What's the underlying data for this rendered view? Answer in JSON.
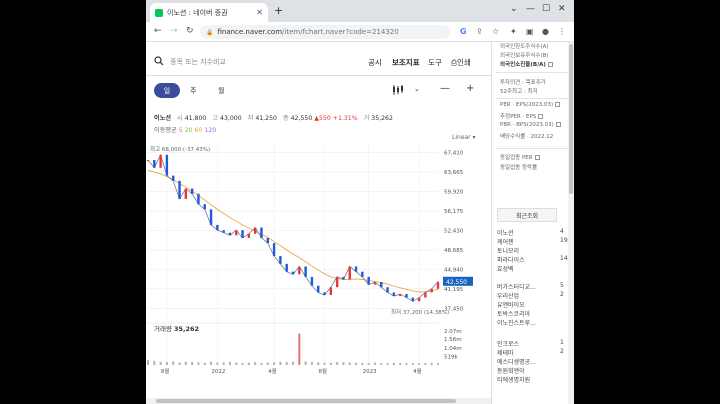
{
  "browser": {
    "tab_title": "이노션 : 네이버 증권",
    "url_host": "finance.naver.com",
    "url_path": "/item/fchart.naver?code=214320"
  },
  "search": {
    "placeholder": "종목 또는 지수비교"
  },
  "menu": {
    "disclosure": "공시",
    "indicator": "보조지표",
    "tools": "도구",
    "print": "인쇄"
  },
  "periods": [
    "일",
    "주",
    "월"
  ],
  "info": {
    "name": "이노션",
    "open_label": "시",
    "open": "41,800",
    "high_label": "고",
    "high": "43,000",
    "low_label": "저",
    "low": "41,250",
    "close_label": "종",
    "close": "42,550",
    "change": "▲550",
    "change_pct": "+1.31%",
    "volume_label": "거",
    "volume": "35,262",
    "ma_label": "이동평균",
    "ma": [
      "5",
      "20",
      "60",
      "120"
    ]
  },
  "chart": {
    "scale": "Linear ▾",
    "volume_label": "거래량",
    "volume_value": "35,262"
  },
  "chart_data": {
    "type": "line",
    "title": "",
    "price_ticks": [
      "67,410",
      "63,665",
      "59,920",
      "56,175",
      "52,430",
      "48,685",
      "44,940",
      "41,195",
      "37,450"
    ],
    "price_ticks_values": [
      67410,
      63665,
      59920,
      56175,
      52430,
      48685,
      44940,
      41195,
      37450
    ],
    "ylim": [
      35577,
      69282
    ],
    "current_price_label": "42,550",
    "current_price": 42550,
    "max_label": "최고 68,000 (-37.43%)",
    "min_label": "최저 37,200 (14.38%)",
    "volume_ticks": [
      "2.07m",
      "1.56m",
      "1.04m",
      "519k"
    ],
    "x_tick_labels": [
      "8월",
      "2022",
      "4월",
      "8월",
      "2023",
      "4월"
    ],
    "x": [
      0,
      2,
      4,
      6,
      8,
      10,
      12,
      14,
      16,
      18,
      20,
      22,
      24,
      26,
      28,
      30,
      32,
      34,
      36,
      38,
      40,
      42,
      44,
      46,
      48,
      50,
      52,
      54,
      56,
      58,
      60,
      62,
      64,
      66,
      68,
      70,
      72,
      74,
      76,
      78,
      80,
      82,
      84,
      86,
      88,
      90,
      92
    ],
    "close": [
      66000,
      64500,
      67000,
      63000,
      62000,
      58500,
      60500,
      59500,
      57500,
      56500,
      53500,
      52500,
      52000,
      51500,
      52500,
      51000,
      51800,
      53000,
      51000,
      50000,
      47500,
      46000,
      44500,
      44000,
      45500,
      43500,
      41800,
      40500,
      40000,
      41500,
      43500,
      43000,
      45500,
      44500,
      43500,
      42000,
      42500,
      41500,
      40500,
      39800,
      40200,
      39500,
      38800,
      39500,
      40500,
      41200,
      42550
    ],
    "ma_long": [
      64000,
      63700,
      63300,
      62800,
      62200,
      61500,
      60800,
      60000,
      59200,
      58300,
      57400,
      56500,
      55700,
      54900,
      54200,
      53500,
      52900,
      52300,
      51700,
      51100,
      50300,
      49500,
      48700,
      47900,
      47200,
      46400,
      45600,
      44800,
      44100,
      43500,
      43200,
      43000,
      43000,
      43100,
      43000,
      42800,
      42600,
      42400,
      42100,
      41700,
      41400,
      41100,
      40800,
      40600,
      40600,
      40800,
      41100
    ],
    "volume": [
      0.3,
      0.25,
      0.2,
      0.18,
      0.22,
      0.15,
      0.2,
      0.18,
      0.17,
      0.14,
      0.2,
      0.15,
      0.16,
      0.18,
      0.15,
      0.12,
      0.14,
      0.18,
      0.12,
      0.15,
      0.16,
      0.2,
      0.18,
      0.2,
      1.9,
      0.22,
      0.17,
      0.16,
      0.14,
      0.15,
      0.18,
      0.17,
      0.16,
      0.14,
      0.13,
      0.12,
      0.14,
      0.12,
      0.11,
      0.13,
      0.12,
      0.11,
      0.12,
      0.1,
      0.12,
      0.14,
      0.11
    ],
    "volume_ylim": [
      0,
      2.3
    ]
  },
  "sidebar": {
    "items": [
      "외국인한도주식수(A)",
      "외국인보유주식수(B)",
      "외국인소진율(B/A)",
      "투자의견 : 목표주가",
      "52주최고 : 최저",
      "PER · EPS(2023.03)",
      "추정PER · EPS",
      "PBR · BPS(2023.03)",
      "배당수익률 · 2022.12",
      "동일업종 PER",
      "동일업종 등락률"
    ],
    "recent_title": "최근조회",
    "recent": [
      {
        "name": "이노션",
        "count": "4"
      },
      {
        "name": "케어젠",
        "count": "19"
      },
      {
        "name": "토니모리",
        "count": ""
      },
      {
        "name": "파라다이스",
        "count": "14"
      },
      {
        "name": "효성벡",
        "count": ""
      },
      {
        "name": "버가스터디교...",
        "count": "5"
      },
      {
        "name": "우리산업",
        "count": "2"
      },
      {
        "name": "유엔바이오",
        "count": ""
      },
      {
        "name": "토박스코리아",
        "count": ""
      },
      {
        "name": "이노진스트루...",
        "count": ""
      },
      {
        "name": "인크로스",
        "count": "1"
      },
      {
        "name": "제테마",
        "count": "2"
      },
      {
        "name": "에스디생명공...",
        "count": ""
      },
      {
        "name": "동원회엔이",
        "count": ""
      },
      {
        "name": "티에생명자원",
        "count": ""
      }
    ]
  },
  "colors": {
    "accent": "#3a4d9a",
    "up": "#e53935",
    "down": "#1e5bd8",
    "price_tag": "#1565c0",
    "ma5": "#e57373",
    "ma20": "#8bc34a",
    "ma60": "#e6a23c",
    "ma120": "#9c6ade"
  }
}
